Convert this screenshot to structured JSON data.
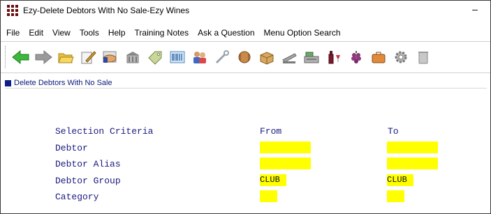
{
  "window": {
    "title": "Ezy-Delete Debtors With No Sale-Ezy Wines",
    "minimize_glyph": "–"
  },
  "menu": [
    "File",
    "Edit",
    "View",
    "Tools",
    "Help",
    "Training Notes",
    "Ask a Question",
    "Menu Option Search"
  ],
  "toolbar": {
    "icons": [
      "back-arrow-icon",
      "forward-arrow-icon",
      "folder-open-icon",
      "pen-paper-icon",
      "handshake-icon",
      "building-icon",
      "tag-icon",
      "barcode-icon",
      "people-icon",
      "wrench-icon",
      "barrel-icon",
      "box-icon",
      "stapler-icon",
      "cash-register-icon",
      "wine-bottle-icon",
      "grapes-icon",
      "briefcase-icon",
      "gear-icon",
      "trash-icon"
    ]
  },
  "tab": {
    "label": "Delete Debtors With No Sale"
  },
  "form": {
    "header": {
      "label": "Selection Criteria",
      "from": "From",
      "to": "To"
    },
    "rows": [
      {
        "label": "Debtor",
        "from": "",
        "to": ""
      },
      {
        "label": "Debtor Alias",
        "from": "",
        "to": ""
      },
      {
        "label": "Debtor Group",
        "from": "CLUB",
        "to": "CLUB"
      },
      {
        "label": "Category",
        "from": "",
        "to": ""
      }
    ]
  },
  "colors": {
    "field_bg": "#ffff00",
    "label_text": "#1a1a80",
    "tab_marker": "#0d1e86"
  }
}
